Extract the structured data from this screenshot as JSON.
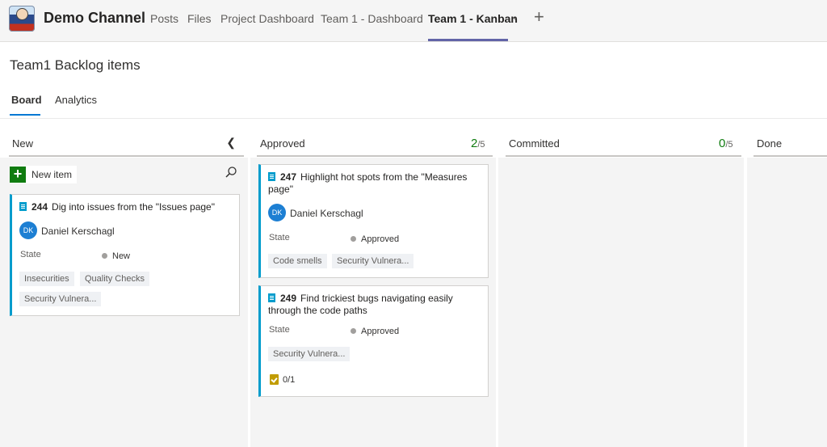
{
  "app": {
    "channel_name": "Demo Channel",
    "tabs": [
      {
        "label": "Posts"
      },
      {
        "label": "Files"
      },
      {
        "label": "Project Dashboard"
      },
      {
        "label": "Team 1 - Dashboard"
      },
      {
        "label": "Team 1 - Kanban",
        "active": true
      }
    ],
    "add_tab_icon": "plus-icon",
    "tab_chevron_icon": "chevron-down-icon",
    "accent_color": "#6264a7"
  },
  "page": {
    "title": "Team1 Backlog items",
    "subtabs": [
      {
        "label": "Board",
        "active": true
      },
      {
        "label": "Analytics"
      }
    ]
  },
  "columns": [
    {
      "name": "New",
      "collapse_icon": "chevron-left-icon"
    },
    {
      "name": "Approved",
      "wip_count": "2",
      "wip_limit": "/5"
    },
    {
      "name": "Committed",
      "wip_count": "0",
      "wip_limit": "/5"
    },
    {
      "name": "Done"
    }
  ],
  "new_item": {
    "label": "New item",
    "icon": "plus-icon",
    "search_icon": "search-icon"
  },
  "state_label": "State",
  "cards": [
    {
      "id": "244",
      "title": "Dig into issues from the \"Issues page\"",
      "assignee_initials": "DK",
      "assignee": "Daniel Kerschagl",
      "state": "New",
      "tags": [
        "Insecurities",
        "Quality Checks",
        "Security Vulnera..."
      ]
    },
    {
      "id": "247",
      "title": "Highlight hot spots from the \"Measures",
      "title_line2": "page\"",
      "assignee_initials": "DK",
      "assignee": "Daniel Kerschagl",
      "state": "Approved",
      "tags": [
        "Code smells",
        "Security Vulnera..."
      ]
    },
    {
      "id": "249",
      "title": "Find trickiest bugs navigating easily",
      "title_line2": "through the code paths",
      "state": "Approved",
      "tags": [
        "Security Vulnera..."
      ],
      "checklist": "0/1"
    }
  ],
  "colors": {
    "card_accent": "#009ccc",
    "wip_ok": "#107c10",
    "avatar": "#1d7fd3",
    "checklist": "#c19c00"
  }
}
